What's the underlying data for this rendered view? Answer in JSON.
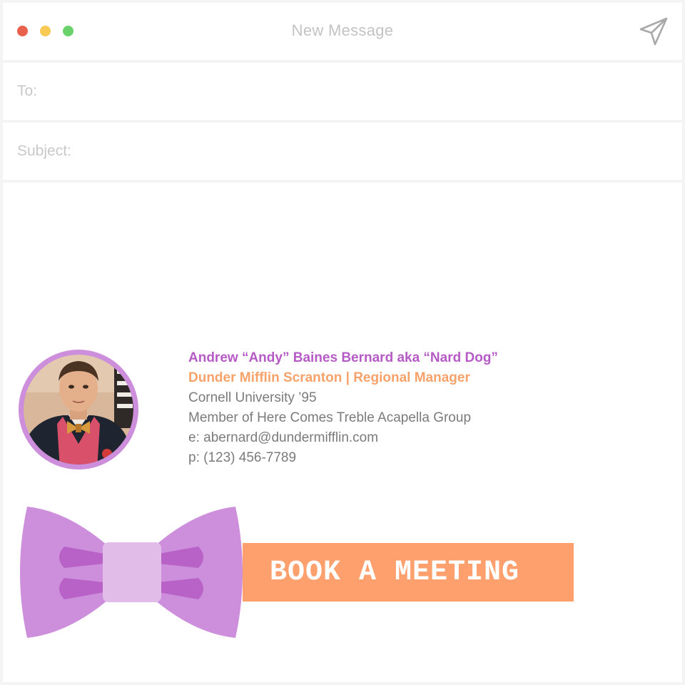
{
  "window": {
    "title": "New Message",
    "traffic_lights": {
      "close": "#e8614d",
      "minimize": "#f8c953",
      "zoom": "#69d26a"
    },
    "send_icon": "paper-plane-icon"
  },
  "fields": {
    "to_label": "To:",
    "subject_label": "Subject:"
  },
  "signature": {
    "name": "Andrew “Andy” Baines Bernard aka “Nard Dog”",
    "company": "Dunder Mifflin Scranton | Regional Manager",
    "education": "Cornell University ’95",
    "membership": "Member of Here Comes Treble Acapella Group",
    "email": "e: abernard@dundermifflin.com",
    "phone": "p: (123) 456-7789",
    "colors": {
      "name": "#b65bc6",
      "company": "#f7a26a",
      "text": "#7b7b7b",
      "avatar_ring": "#cd8fdc"
    }
  },
  "cta": {
    "label": "BOOK A MEETING",
    "background": "#fda06d",
    "bow_color": "#cd8fdc",
    "bow_icon": "bow-tie-icon"
  }
}
